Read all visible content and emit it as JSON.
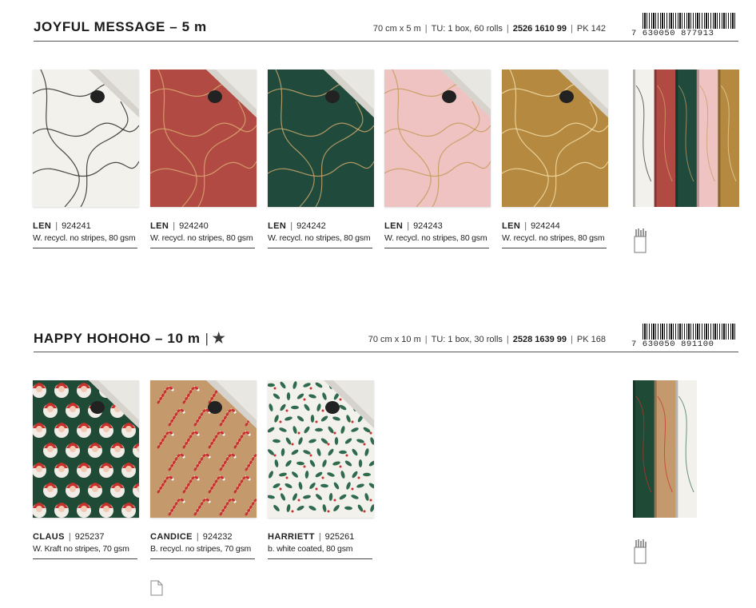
{
  "sections": [
    {
      "title": "JOYFUL MESSAGE – 5 m",
      "size": "70 cm x 5 m",
      "tu": "TU: 1 box, 60 rolls",
      "article": "2526 1610 99",
      "pk": "PK 142",
      "barcode": "7 630050 877913",
      "products": [
        {
          "name": "LEN",
          "code": "924241",
          "desc": "W. recycl. no stripes, 80 gsm",
          "color": "#f3f1ec",
          "ink": "#2b2b2b"
        },
        {
          "name": "LEN",
          "code": "924240",
          "desc": "W. recycl. no stripes, 80 gsm",
          "color": "#b14a43",
          "ink": "#d9a870"
        },
        {
          "name": "LEN",
          "code": "924242",
          "desc": "W. recycl. no stripes, 80 gsm",
          "color": "#1f4a3c",
          "ink": "#c9a46a"
        },
        {
          "name": "LEN",
          "code": "924243",
          "desc": "W. recycl. no stripes, 80 gsm",
          "color": "#efc3c2",
          "ink": "#c59a5c"
        },
        {
          "name": "LEN",
          "code": "924244",
          "desc": "W. recycl. no stripes, 80 gsm",
          "color": "#b5893f",
          "ink": "#f1dca6"
        }
      ]
    },
    {
      "title": "HAPPY HOHOHO – 10 m",
      "star": "★",
      "size": "70 cm x 10 m",
      "tu": "TU: 1 box, 30 rolls",
      "article": "2528 1639 99",
      "pk": "PK 168",
      "barcode": "7 630050 891100",
      "products": [
        {
          "name": "CLAUS",
          "code": "925237",
          "desc": "W. Kraft no stripes, 70 gsm",
          "color": "#1e4a36",
          "ink": "#c8302c"
        },
        {
          "name": "CANDICE",
          "code": "924232",
          "desc": "B. recycl. no stripes, 70 gsm",
          "color": "#c49a6c",
          "ink": "#c8302c"
        },
        {
          "name": "HARRIETT",
          "code": "925261",
          "desc": "b. white coated, 80 gsm",
          "color": "#f2f1ec",
          "ink": "#2f6a4c"
        }
      ]
    }
  ]
}
